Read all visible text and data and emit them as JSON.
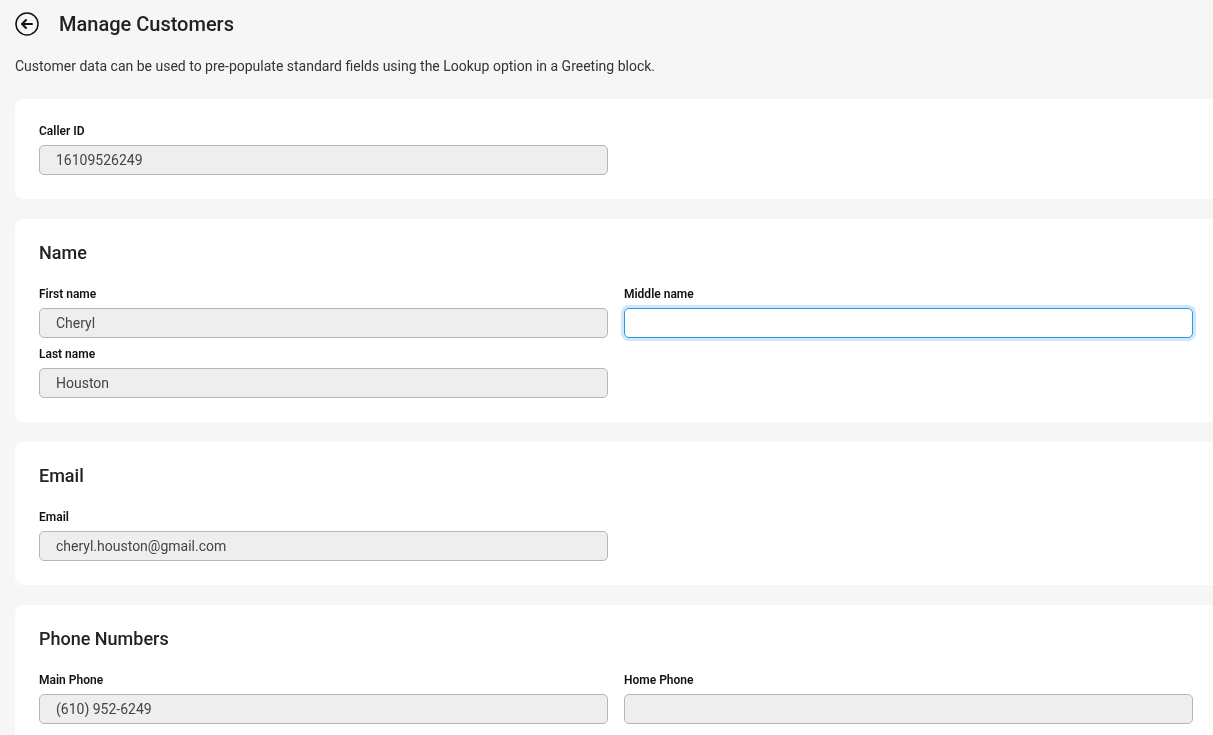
{
  "header": {
    "title": "Manage Customers"
  },
  "description": "Customer data can be used to pre-populate standard fields using the Lookup option in a Greeting block.",
  "sections": [
    {
      "fields": [
        {
          "label": "Caller ID",
          "value": "16109526249",
          "disabled": true,
          "focused": false
        }
      ]
    },
    {
      "title": "Name",
      "fields": [
        {
          "label": "First name",
          "value": "Cheryl",
          "disabled": true,
          "focused": false
        },
        {
          "label": "Middle name",
          "disabled": false,
          "focused": true
        },
        {
          "label": "Last name",
          "value": "Houston",
          "disabled": true,
          "focused": false
        }
      ]
    },
    {
      "title": "Email",
      "fields": [
        {
          "label": "Email",
          "value": "cheryl.houston@gmail.com",
          "disabled": true,
          "focused": false
        }
      ]
    },
    {
      "title": "Phone Numbers",
      "fields": [
        {
          "label": "Main Phone",
          "value": "(610) 952-6249",
          "disabled": true,
          "focused": false
        },
        {
          "label": "Home Phone",
          "disabled": true,
          "focused": false
        }
      ]
    }
  ]
}
